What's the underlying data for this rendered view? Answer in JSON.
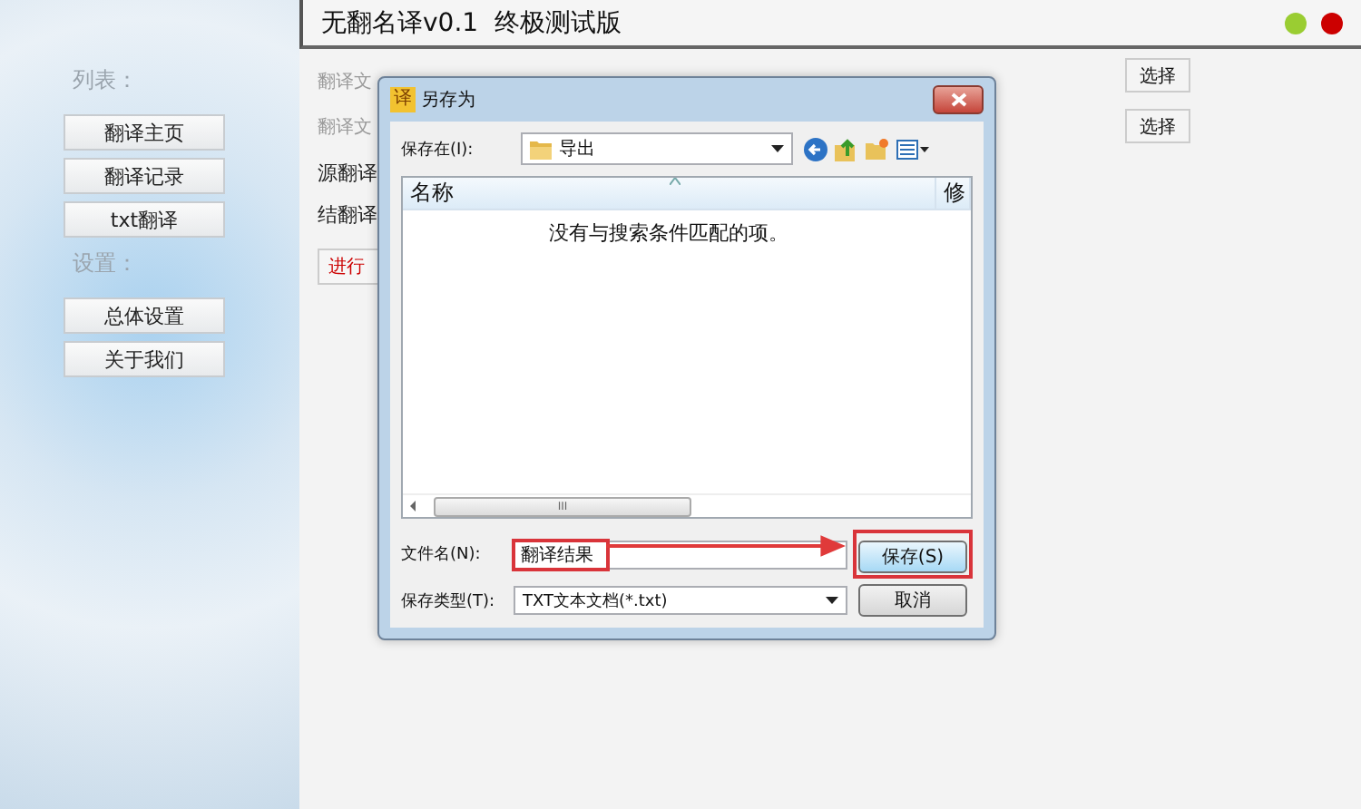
{
  "app": {
    "title": "无翻名译v0.1  终极测试版",
    "window_controls": [
      {
        "color": "#9acd32"
      },
      {
        "color": "#cc0000"
      }
    ]
  },
  "sidebar": {
    "sections": [
      {
        "label": "列表：",
        "items": [
          "翻译主页",
          "翻译记录",
          "txt翻译"
        ]
      },
      {
        "label": "设置：",
        "items": [
          "总体设置",
          "关于我们"
        ]
      }
    ]
  },
  "main": {
    "rows": [
      {
        "kind": "faint",
        "label": "翻译文"
      },
      {
        "kind": "faint",
        "label": "翻译文"
      },
      {
        "kind": "bold",
        "label": "源翻译"
      },
      {
        "kind": "bold",
        "label": "结翻译"
      },
      {
        "kind": "button",
        "label": "进行"
      }
    ],
    "choose_buttons": [
      "选择",
      "选择"
    ]
  },
  "dialog": {
    "icon_text": "译",
    "title": "另存为",
    "location_label": "保存在(I):",
    "location": "导出",
    "columns": [
      "名称",
      "修"
    ],
    "empty_message": "没有与搜索条件匹配的项。",
    "scroll_grip": "III",
    "filename_label": "文件名(N):",
    "filename": "翻译结果",
    "filetype_label": "保存类型(T):",
    "filetype": "TXT文本文档(*.txt)",
    "buttons": [
      "保存(S)",
      "取消"
    ]
  }
}
